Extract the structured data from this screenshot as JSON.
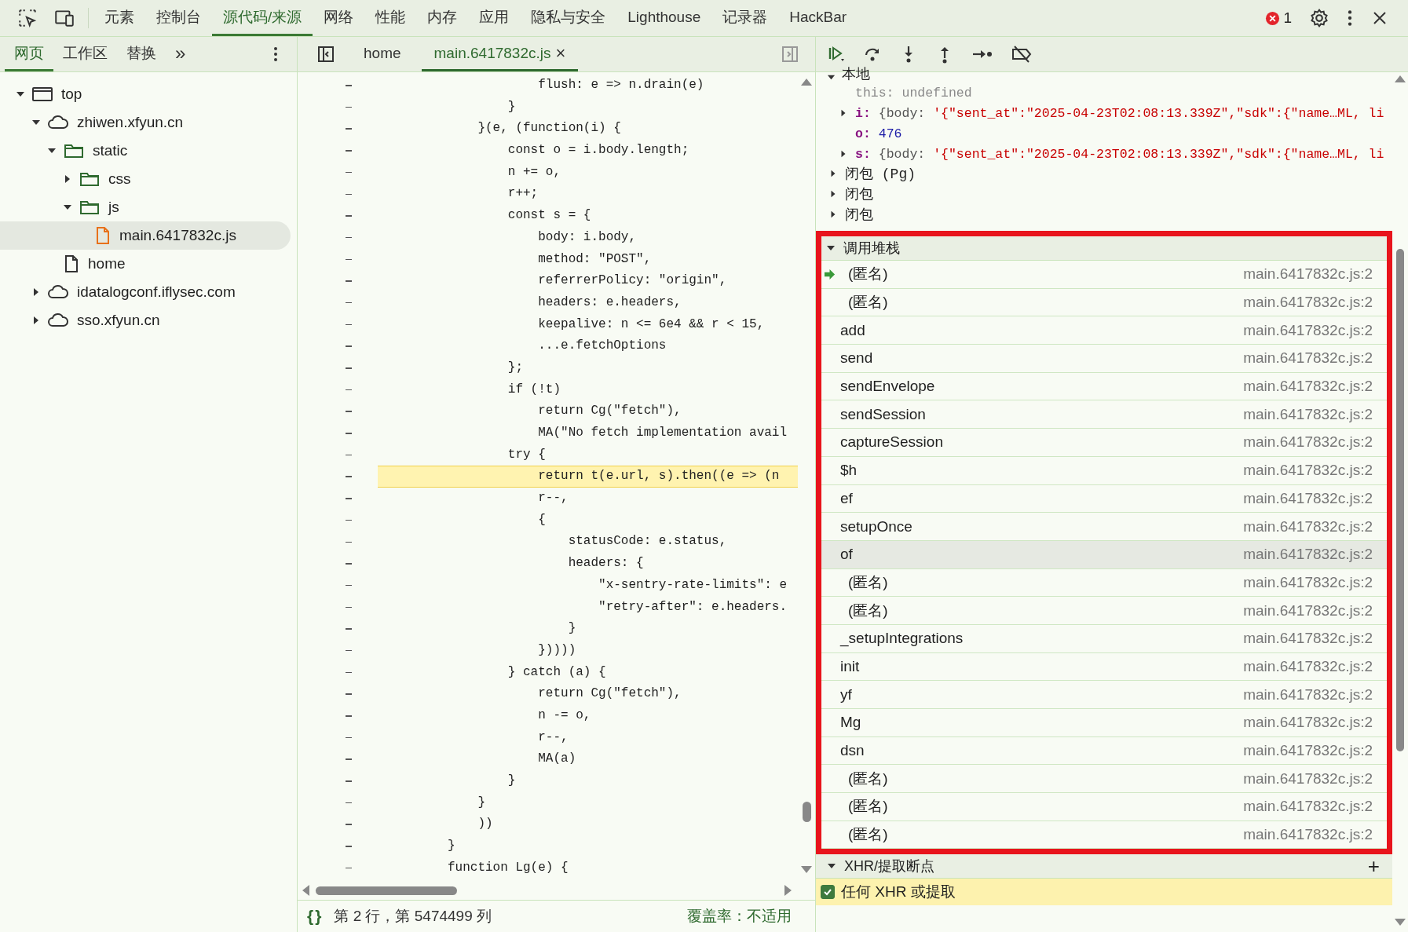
{
  "main_toolbar": {
    "tabs": [
      {
        "label": "元素",
        "selected": false
      },
      {
        "label": "控制台",
        "selected": false
      },
      {
        "label": "源代码/来源",
        "selected": true
      },
      {
        "label": "网络",
        "selected": false
      },
      {
        "label": "性能",
        "selected": false
      },
      {
        "label": "内存",
        "selected": false
      },
      {
        "label": "应用",
        "selected": false
      },
      {
        "label": "隐私与安全",
        "selected": false
      },
      {
        "label": "Lighthouse",
        "selected": false
      },
      {
        "label": "记录器",
        "selected": false
      },
      {
        "label": "HackBar",
        "selected": false
      }
    ],
    "error_count": "1"
  },
  "navigator": {
    "tabs": [
      {
        "label": "网页",
        "selected": true
      },
      {
        "label": "工作区",
        "selected": false
      },
      {
        "label": "替换",
        "selected": false
      }
    ],
    "more": "»",
    "tree": [
      {
        "label": "top",
        "kind": "window",
        "expanded": true,
        "selected": false,
        "children": [
          {
            "label": "zhiwen.xfyun.cn",
            "kind": "cloud",
            "expanded": true,
            "selected": false,
            "children": [
              {
                "label": "static",
                "kind": "folder",
                "expanded": true,
                "selected": false,
                "children": [
                  {
                    "label": "css",
                    "kind": "folder",
                    "expanded": false,
                    "selected": false
                  },
                  {
                    "label": "js",
                    "kind": "folder",
                    "expanded": true,
                    "selected": false,
                    "children": [
                      {
                        "label": "main.6417832c.js",
                        "kind": "script",
                        "selected": true
                      }
                    ]
                  }
                ]
              },
              {
                "label": "home",
                "kind": "document",
                "selected": false
              }
            ]
          },
          {
            "label": "idatalogconf.iflysec.com",
            "kind": "cloud",
            "expanded": false,
            "selected": false
          },
          {
            "label": "sso.xfyun.cn",
            "kind": "cloud",
            "expanded": false,
            "selected": false
          }
        ]
      }
    ]
  },
  "editor": {
    "tabs": [
      {
        "label": "home",
        "selected": false,
        "closable": false
      },
      {
        "label": "main.6417832c.js",
        "selected": true,
        "closable": true
      }
    ],
    "close_glyph": "×",
    "lines": [
      {
        "text": "            flush: e => n.drain(e)",
        "highlighted": false
      },
      {
        "text": "        }",
        "highlighted": false
      },
      {
        "text": "    }(e, (function(i) {",
        "highlighted": false
      },
      {
        "text": "        const o = i.body.length;",
        "highlighted": false
      },
      {
        "text": "        n += o,",
        "highlighted": false
      },
      {
        "text": "        r++;",
        "highlighted": false
      },
      {
        "text": "        const s = {",
        "highlighted": false
      },
      {
        "text": "            body: i.body,",
        "highlighted": false
      },
      {
        "text": "            method: \"POST\",",
        "highlighted": false
      },
      {
        "text": "            referrerPolicy: \"origin\",",
        "highlighted": false
      },
      {
        "text": "            headers: e.headers,",
        "highlighted": false
      },
      {
        "text": "            keepalive: n <= 6e4 && r < 15,",
        "highlighted": false
      },
      {
        "text": "            ...e.fetchOptions",
        "highlighted": false
      },
      {
        "text": "        };",
        "highlighted": false
      },
      {
        "text": "        if (!t)",
        "highlighted": false
      },
      {
        "text": "            return Cg(\"fetch\"),",
        "highlighted": false
      },
      {
        "text": "            MA(\"No fetch implementation avail",
        "highlighted": false
      },
      {
        "text": "        try {",
        "highlighted": false
      },
      {
        "text": "            return t(e.url, s).then((e => (n",
        "highlighted": true
      },
      {
        "text": "            r--,",
        "highlighted": false
      },
      {
        "text": "            {",
        "highlighted": false
      },
      {
        "text": "                statusCode: e.status,",
        "highlighted": false
      },
      {
        "text": "                headers: {",
        "highlighted": false
      },
      {
        "text": "                    \"x-sentry-rate-limits\": e",
        "highlighted": false
      },
      {
        "text": "                    \"retry-after\": e.headers.",
        "highlighted": false
      },
      {
        "text": "                }",
        "highlighted": false
      },
      {
        "text": "            }))))",
        "highlighted": false
      },
      {
        "text": "        } catch (a) {",
        "highlighted": false
      },
      {
        "text": "            return Cg(\"fetch\"),",
        "highlighted": false
      },
      {
        "text": "            n -= o,",
        "highlighted": false
      },
      {
        "text": "            r--,",
        "highlighted": false
      },
      {
        "text": "            MA(a)",
        "highlighted": false
      },
      {
        "text": "        }",
        "highlighted": false
      },
      {
        "text": "    }",
        "highlighted": false
      },
      {
        "text": "    ))",
        "highlighted": false
      },
      {
        "text": "}",
        "highlighted": false
      },
      {
        "text": "function Lg(e) {",
        "highlighted": false
      }
    ],
    "status": {
      "format_glyph": "{}",
      "position": "第 2 行，第 5474499 列",
      "coverage": "覆盖率：不适用"
    }
  },
  "scope": {
    "local_title": "本地",
    "variables": [
      {
        "name": "this:",
        "kind": "undefined",
        "value": "undefined"
      },
      {
        "name": "i:",
        "kind": "object",
        "prefix": "{body: ",
        "value": "'{\"sent_at\":\"2025-04-23T02:08:13.339Z\",\"sdk\":{\"name…ML, li",
        "expanded": false
      },
      {
        "name": "o:",
        "kind": "number",
        "value": "476"
      },
      {
        "name": "s:",
        "kind": "object",
        "prefix": "{body: ",
        "value": "'{\"sent_at\":\"2025-04-23T02:08:13.339Z\",\"sdk\":{\"name…ML, li",
        "expanded": false
      }
    ],
    "closures": [
      {
        "label": "闭包 (Pg)",
        "expanded": false
      },
      {
        "label": "闭包",
        "expanded": false
      },
      {
        "label": "闭包",
        "expanded": false
      }
    ]
  },
  "call_stack": {
    "title": "调用堆栈",
    "expanded": true,
    "frames": [
      {
        "name": "(匿名)",
        "location": "main.6417832c.js:2",
        "anonymous": true,
        "current": true,
        "selected": false
      },
      {
        "name": "(匿名)",
        "location": "main.6417832c.js:2",
        "anonymous": true,
        "current": false,
        "selected": false
      },
      {
        "name": "add",
        "location": "main.6417832c.js:2",
        "anonymous": false,
        "current": false,
        "selected": false
      },
      {
        "name": "send",
        "location": "main.6417832c.js:2",
        "anonymous": false,
        "current": false,
        "selected": false
      },
      {
        "name": "sendEnvelope",
        "location": "main.6417832c.js:2",
        "anonymous": false,
        "current": false,
        "selected": false
      },
      {
        "name": "sendSession",
        "location": "main.6417832c.js:2",
        "anonymous": false,
        "current": false,
        "selected": false
      },
      {
        "name": "captureSession",
        "location": "main.6417832c.js:2",
        "anonymous": false,
        "current": false,
        "selected": false
      },
      {
        "name": "$h",
        "location": "main.6417832c.js:2",
        "anonymous": false,
        "current": false,
        "selected": false
      },
      {
        "name": "ef",
        "location": "main.6417832c.js:2",
        "anonymous": false,
        "current": false,
        "selected": false
      },
      {
        "name": "setupOnce",
        "location": "main.6417832c.js:2",
        "anonymous": false,
        "current": false,
        "selected": false
      },
      {
        "name": "of",
        "location": "main.6417832c.js:2",
        "anonymous": false,
        "current": false,
        "selected": true
      },
      {
        "name": "(匿名)",
        "location": "main.6417832c.js:2",
        "anonymous": true,
        "current": false,
        "selected": false
      },
      {
        "name": "(匿名)",
        "location": "main.6417832c.js:2",
        "anonymous": true,
        "current": false,
        "selected": false
      },
      {
        "name": "_setupIntegrations",
        "location": "main.6417832c.js:2",
        "anonymous": false,
        "current": false,
        "selected": false
      },
      {
        "name": "init",
        "location": "main.6417832c.js:2",
        "anonymous": false,
        "current": false,
        "selected": false
      },
      {
        "name": "yf",
        "location": "main.6417832c.js:2",
        "anonymous": false,
        "current": false,
        "selected": false
      },
      {
        "name": "Mg",
        "location": "main.6417832c.js:2",
        "anonymous": false,
        "current": false,
        "selected": false
      },
      {
        "name": "dsn",
        "location": "main.6417832c.js:2",
        "anonymous": false,
        "current": false,
        "selected": false
      },
      {
        "name": "(匿名)",
        "location": "main.6417832c.js:2",
        "anonymous": true,
        "current": false,
        "selected": false
      },
      {
        "name": "(匿名)",
        "location": "main.6417832c.js:2",
        "anonymous": true,
        "current": false,
        "selected": false
      },
      {
        "name": "(匿名)",
        "location": "main.6417832c.js:2",
        "anonymous": true,
        "current": false,
        "selected": false
      }
    ]
  },
  "xhr_breakpoints": {
    "title": "XHR/提取断点",
    "expanded": true,
    "add_glyph": "+",
    "items": [
      {
        "label": "任何 XHR 或提取",
        "checked": true,
        "hit": true
      }
    ]
  }
}
